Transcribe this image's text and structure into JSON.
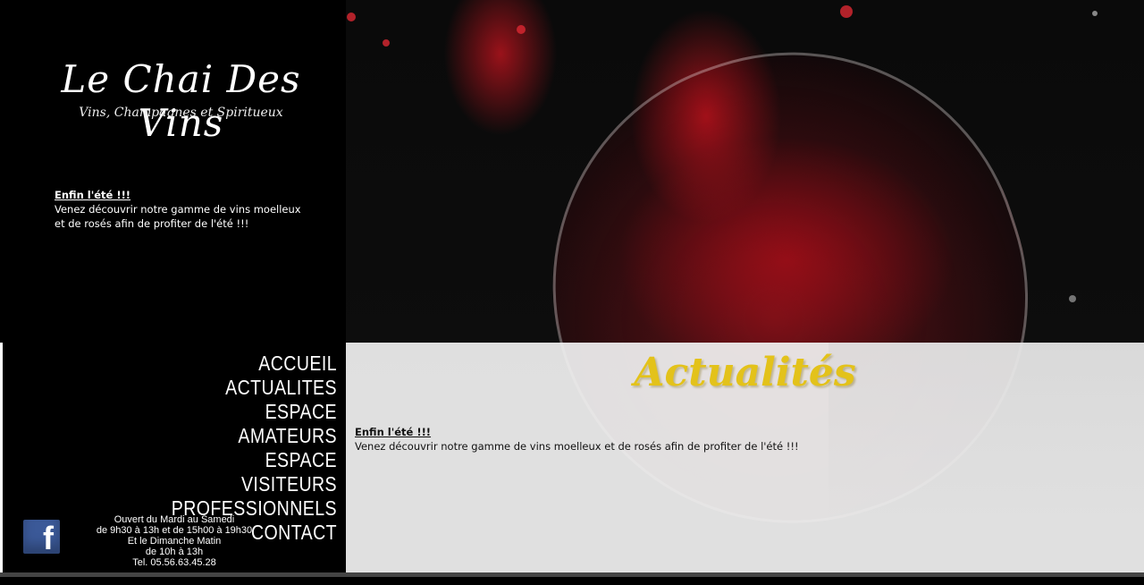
{
  "brand": {
    "title": "Le Chai Des Vins",
    "subtitle": "Vins, Champagnes et Spiritueux"
  },
  "sidebar_news": {
    "title": "Enfin l'été !!!",
    "line1": "Venez découvrir notre gamme de vins moelleux",
    "line2": "et de rosés afin de profiter de l'été !!!"
  },
  "menu": [
    "ACCUEIL",
    "ACTUALITES",
    "ESPACE AMATEURS",
    "ESPACE VISITEURS",
    "PROFESSIONNELS",
    "CONTACT"
  ],
  "hours": {
    "line1": "Ouvert du Mardi au Samedi",
    "line2": "de 9h30 à 13h et de 15h00 à 19h30",
    "line3": "Et le Dimanche Matin",
    "line4": "de 10h à 13h",
    "line5": "Tel. 05.56.63.45.28"
  },
  "facebook": {
    "glyph": "f",
    "icon": "facebook-icon"
  },
  "main": {
    "heading": "Actualités",
    "news_title": "Enfin l'été !!!",
    "news_text": "Venez découvrir notre gamme de vins moelleux et de rosés afin de profiter de l'été !!!"
  },
  "colors": {
    "heading": "#e3c21a",
    "background": "#000000",
    "panel": "#f0f0f0",
    "facebook": "#3b5998"
  }
}
